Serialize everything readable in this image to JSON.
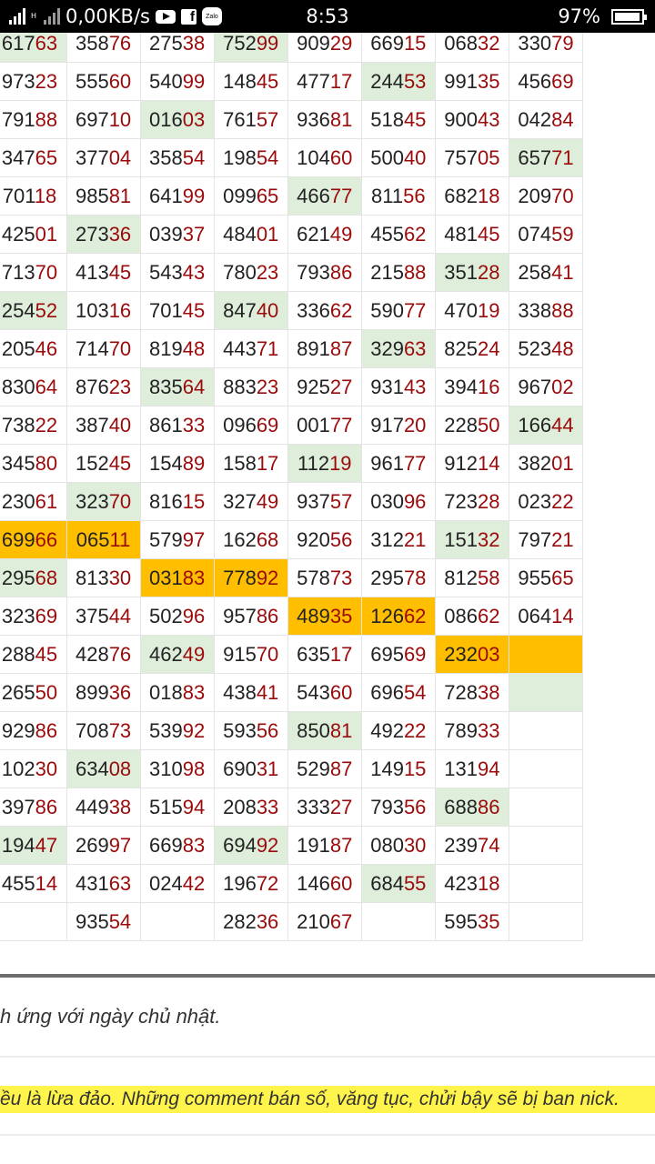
{
  "status_bar": {
    "network_speed": "0,00KB/s",
    "network_type": "H",
    "app_zalo": "Zalo",
    "app_fb": "f",
    "time": "8:53",
    "battery": "97%",
    "battery_level": 0.97
  },
  "table": {
    "rows": [
      [
        {
          "v": "",
          "bg": "g"
        },
        {
          "v": "61763",
          "bg": "g"
        },
        {
          "v": "35876",
          "bg": ""
        },
        {
          "v": "27538",
          "bg": ""
        },
        {
          "v": "75299",
          "bg": "g"
        },
        {
          "v": "90929",
          "bg": ""
        },
        {
          "v": "66915",
          "bg": ""
        },
        {
          "v": "06832",
          "bg": ""
        },
        {
          "v": "33079",
          "bg": ""
        }
      ],
      [
        {
          "v": "",
          "bg": ""
        },
        {
          "v": "97323",
          "bg": ""
        },
        {
          "v": "55560",
          "bg": ""
        },
        {
          "v": "54099",
          "bg": ""
        },
        {
          "v": "14845",
          "bg": ""
        },
        {
          "v": "47717",
          "bg": ""
        },
        {
          "v": "24453",
          "bg": "g"
        },
        {
          "v": "99135",
          "bg": ""
        },
        {
          "v": "45669",
          "bg": ""
        }
      ],
      [
        {
          "v": "",
          "bg": ""
        },
        {
          "v": "79188",
          "bg": ""
        },
        {
          "v": "69710",
          "bg": ""
        },
        {
          "v": "01603",
          "bg": "g"
        },
        {
          "v": "76157",
          "bg": ""
        },
        {
          "v": "93681",
          "bg": ""
        },
        {
          "v": "51845",
          "bg": ""
        },
        {
          "v": "90043",
          "bg": ""
        },
        {
          "v": "04284",
          "bg": ""
        }
      ],
      [
        {
          "v": "",
          "bg": "g"
        },
        {
          "v": "34765",
          "bg": ""
        },
        {
          "v": "37704",
          "bg": ""
        },
        {
          "v": "35854",
          "bg": ""
        },
        {
          "v": "19854",
          "bg": ""
        },
        {
          "v": "10460",
          "bg": ""
        },
        {
          "v": "50040",
          "bg": ""
        },
        {
          "v": "75705",
          "bg": ""
        },
        {
          "v": "65771",
          "bg": "g"
        }
      ],
      [
        {
          "v": "",
          "bg": ""
        },
        {
          "v": "70118",
          "bg": ""
        },
        {
          "v": "98581",
          "bg": ""
        },
        {
          "v": "64199",
          "bg": ""
        },
        {
          "v": "09965",
          "bg": ""
        },
        {
          "v": "46677",
          "bg": "g"
        },
        {
          "v": "81156",
          "bg": ""
        },
        {
          "v": "68218",
          "bg": ""
        },
        {
          "v": "20970",
          "bg": ""
        }
      ],
      [
        {
          "v": "",
          "bg": ""
        },
        {
          "v": "42501",
          "bg": ""
        },
        {
          "v": "27336",
          "bg": "g"
        },
        {
          "v": "03937",
          "bg": ""
        },
        {
          "v": "48401",
          "bg": ""
        },
        {
          "v": "62149",
          "bg": ""
        },
        {
          "v": "45562",
          "bg": ""
        },
        {
          "v": "48145",
          "bg": ""
        },
        {
          "v": "07459",
          "bg": ""
        }
      ],
      [
        {
          "v": "",
          "bg": ""
        },
        {
          "v": "71370",
          "bg": ""
        },
        {
          "v": "41345",
          "bg": ""
        },
        {
          "v": "54343",
          "bg": ""
        },
        {
          "v": "78023",
          "bg": ""
        },
        {
          "v": "79386",
          "bg": ""
        },
        {
          "v": "21588",
          "bg": ""
        },
        {
          "v": "35128",
          "bg": "g"
        },
        {
          "v": "25841",
          "bg": ""
        }
      ],
      [
        {
          "v": "",
          "bg": ""
        },
        {
          "v": "25452",
          "bg": "g"
        },
        {
          "v": "10316",
          "bg": ""
        },
        {
          "v": "70145",
          "bg": ""
        },
        {
          "v": "84740",
          "bg": "g"
        },
        {
          "v": "33662",
          "bg": ""
        },
        {
          "v": "59077",
          "bg": ""
        },
        {
          "v": "47019",
          "bg": ""
        },
        {
          "v": "33888",
          "bg": ""
        }
      ],
      [
        {
          "v": "",
          "bg": ""
        },
        {
          "v": "20546",
          "bg": ""
        },
        {
          "v": "71470",
          "bg": ""
        },
        {
          "v": "81948",
          "bg": ""
        },
        {
          "v": "44371",
          "bg": ""
        },
        {
          "v": "89187",
          "bg": ""
        },
        {
          "v": "32963",
          "bg": "g"
        },
        {
          "v": "82524",
          "bg": ""
        },
        {
          "v": "52348",
          "bg": ""
        }
      ],
      [
        {
          "v": "",
          "bg": ""
        },
        {
          "v": "83064",
          "bg": ""
        },
        {
          "v": "87623",
          "bg": ""
        },
        {
          "v": "83564",
          "bg": "g"
        },
        {
          "v": "88323",
          "bg": ""
        },
        {
          "v": "92527",
          "bg": ""
        },
        {
          "v": "93143",
          "bg": ""
        },
        {
          "v": "39416",
          "bg": ""
        },
        {
          "v": "96702",
          "bg": ""
        }
      ],
      [
        {
          "v": "",
          "bg": "g"
        },
        {
          "v": "73822",
          "bg": ""
        },
        {
          "v": "38740",
          "bg": ""
        },
        {
          "v": "86133",
          "bg": ""
        },
        {
          "v": "09669",
          "bg": ""
        },
        {
          "v": "00177",
          "bg": ""
        },
        {
          "v": "91720",
          "bg": ""
        },
        {
          "v": "22850",
          "bg": ""
        },
        {
          "v": "16644",
          "bg": "g"
        }
      ],
      [
        {
          "v": "",
          "bg": ""
        },
        {
          "v": "34580",
          "bg": ""
        },
        {
          "v": "15245",
          "bg": ""
        },
        {
          "v": "15489",
          "bg": ""
        },
        {
          "v": "15817",
          "bg": ""
        },
        {
          "v": "11219",
          "bg": "g"
        },
        {
          "v": "96177",
          "bg": ""
        },
        {
          "v": "91214",
          "bg": ""
        },
        {
          "v": "38201",
          "bg": ""
        }
      ],
      [
        {
          "v": "",
          "bg": ""
        },
        {
          "v": "23061",
          "bg": ""
        },
        {
          "v": "32370",
          "bg": "g"
        },
        {
          "v": "81615",
          "bg": ""
        },
        {
          "v": "32749",
          "bg": ""
        },
        {
          "v": "93757",
          "bg": ""
        },
        {
          "v": "03096",
          "bg": ""
        },
        {
          "v": "72328",
          "bg": ""
        },
        {
          "v": "02322",
          "bg": ""
        }
      ],
      [
        {
          "v": "",
          "bg": ""
        },
        {
          "v": "69966",
          "bg": "o"
        },
        {
          "v": "06511",
          "bg": "o"
        },
        {
          "v": "57997",
          "bg": ""
        },
        {
          "v": "16268",
          "bg": ""
        },
        {
          "v": "92056",
          "bg": ""
        },
        {
          "v": "31221",
          "bg": ""
        },
        {
          "v": "15132",
          "bg": "g"
        },
        {
          "v": "79721",
          "bg": ""
        }
      ],
      [
        {
          "v": "",
          "bg": ""
        },
        {
          "v": "29568",
          "bg": "g"
        },
        {
          "v": "81330",
          "bg": ""
        },
        {
          "v": "03183",
          "bg": "o"
        },
        {
          "v": "77892",
          "bg": "o"
        },
        {
          "v": "57873",
          "bg": ""
        },
        {
          "v": "29578",
          "bg": ""
        },
        {
          "v": "81258",
          "bg": ""
        },
        {
          "v": "95565",
          "bg": ""
        }
      ],
      [
        {
          "v": "",
          "bg": ""
        },
        {
          "v": "32369",
          "bg": ""
        },
        {
          "v": "37544",
          "bg": ""
        },
        {
          "v": "50296",
          "bg": ""
        },
        {
          "v": "95786",
          "bg": ""
        },
        {
          "v": "48935",
          "bg": "o"
        },
        {
          "v": "12662",
          "bg": "o"
        },
        {
          "v": "08662",
          "bg": ""
        },
        {
          "v": "06414",
          "bg": ""
        }
      ],
      [
        {
          "v": "",
          "bg": ""
        },
        {
          "v": "28845",
          "bg": ""
        },
        {
          "v": "42876",
          "bg": ""
        },
        {
          "v": "46249",
          "bg": "g"
        },
        {
          "v": "91570",
          "bg": ""
        },
        {
          "v": "63517",
          "bg": ""
        },
        {
          "v": "69569",
          "bg": ""
        },
        {
          "v": "23203",
          "bg": "o"
        },
        {
          "v": "",
          "bg": "o"
        }
      ],
      [
        {
          "v": "",
          "bg": "g"
        },
        {
          "v": "26550",
          "bg": ""
        },
        {
          "v": "89936",
          "bg": ""
        },
        {
          "v": "01883",
          "bg": ""
        },
        {
          "v": "43841",
          "bg": ""
        },
        {
          "v": "54360",
          "bg": ""
        },
        {
          "v": "69654",
          "bg": ""
        },
        {
          "v": "72838",
          "bg": ""
        },
        {
          "v": "",
          "bg": "g"
        }
      ],
      [
        {
          "v": "",
          "bg": ""
        },
        {
          "v": "92986",
          "bg": ""
        },
        {
          "v": "70873",
          "bg": ""
        },
        {
          "v": "53992",
          "bg": ""
        },
        {
          "v": "59356",
          "bg": ""
        },
        {
          "v": "85081",
          "bg": "g"
        },
        {
          "v": "49222",
          "bg": ""
        },
        {
          "v": "78933",
          "bg": ""
        },
        {
          "v": "",
          "bg": ""
        }
      ],
      [
        {
          "v": "",
          "bg": ""
        },
        {
          "v": "10230",
          "bg": ""
        },
        {
          "v": "63408",
          "bg": "g"
        },
        {
          "v": "31098",
          "bg": ""
        },
        {
          "v": "69031",
          "bg": ""
        },
        {
          "v": "52987",
          "bg": ""
        },
        {
          "v": "14915",
          "bg": ""
        },
        {
          "v": "13194",
          "bg": ""
        },
        {
          "v": "",
          "bg": ""
        }
      ],
      [
        {
          "v": "",
          "bg": ""
        },
        {
          "v": "39786",
          "bg": ""
        },
        {
          "v": "44938",
          "bg": ""
        },
        {
          "v": "51594",
          "bg": ""
        },
        {
          "v": "20833",
          "bg": ""
        },
        {
          "v": "33327",
          "bg": ""
        },
        {
          "v": "79356",
          "bg": ""
        },
        {
          "v": "68886",
          "bg": "g"
        },
        {
          "v": "",
          "bg": ""
        }
      ],
      [
        {
          "v": "",
          "bg": ""
        },
        {
          "v": "19447",
          "bg": "g"
        },
        {
          "v": "26997",
          "bg": ""
        },
        {
          "v": "66983",
          "bg": ""
        },
        {
          "v": "69492",
          "bg": "g"
        },
        {
          "v": "19187",
          "bg": ""
        },
        {
          "v": "08030",
          "bg": ""
        },
        {
          "v": "23974",
          "bg": ""
        },
        {
          "v": "",
          "bg": ""
        }
      ],
      [
        {
          "v": "",
          "bg": ""
        },
        {
          "v": "45514",
          "bg": ""
        },
        {
          "v": "43163",
          "bg": ""
        },
        {
          "v": "02442",
          "bg": ""
        },
        {
          "v": "19672",
          "bg": ""
        },
        {
          "v": "14660",
          "bg": ""
        },
        {
          "v": "68455",
          "bg": "g"
        },
        {
          "v": "42318",
          "bg": ""
        },
        {
          "v": "",
          "bg": ""
        }
      ],
      [
        {
          "v": "",
          "bg": ""
        },
        {
          "v": "",
          "bg": ""
        },
        {
          "v": "93554",
          "bg": ""
        },
        {
          "v": "",
          "bg": ""
        },
        {
          "v": "28236",
          "bg": ""
        },
        {
          "v": "21067",
          "bg": ""
        },
        {
          "v": "",
          "bg": ""
        },
        {
          "v": "59535",
          "bg": ""
        },
        {
          "v": "",
          "bg": ""
        }
      ]
    ]
  },
  "footer": {
    "note": "h ứng với ngày chủ nhật.",
    "warning": "ều là lừa đảo. Những comment bán số, văng tục, chửi bậy sẽ bị ban nick."
  },
  "colors": {
    "green_highlight": "#deeedb",
    "orange_highlight": "#ffbe00",
    "tail_digits": "#9b0a0a",
    "warning_bg": "#fff44c"
  }
}
